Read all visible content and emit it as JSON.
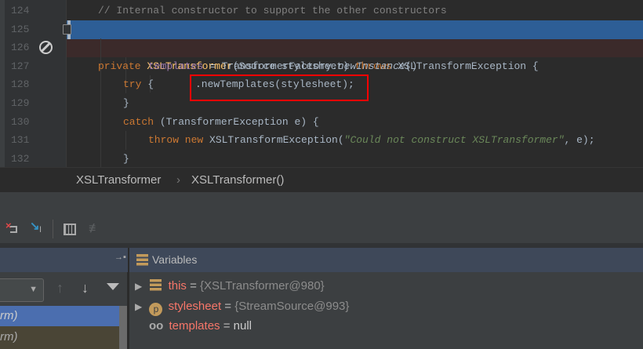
{
  "editor": {
    "lines": [
      {
        "num": "124"
      },
      {
        "num": "125"
      },
      {
        "num": "126"
      },
      {
        "num": "127"
      },
      {
        "num": "128"
      },
      {
        "num": "129"
      },
      {
        "num": "130"
      },
      {
        "num": "131"
      },
      {
        "num": "132"
      }
    ],
    "code": {
      "l124": "// Internal constructor to support the other constructors",
      "l125_kw": "private",
      "l125_fn": "XSLTransformer",
      "l125_a": "(Source stylesheet) ",
      "l125_kw2": "throws",
      "l125_b": " XSLTransformException {",
      "l126_kw": "try",
      "l126_b": " {",
      "l127_fld": "templates",
      "l127_a": " = TransformerFactory.",
      "l127_it": "newInstance",
      "l127_b": "()",
      "l128": ".newTemplates(stylesheet);",
      "l129": "}",
      "l130_kw": "catch",
      "l130_b": " (TransformerException e) {",
      "l131_kw": "throw new",
      "l131_a": " XSLTransformException(",
      "l131_str": "\"Could not construct XSLTransformer\"",
      "l131_b": ", e);",
      "l132": "}"
    }
  },
  "breadcrumb": {
    "items": [
      "XSLTransformer",
      "XSLTransformer()"
    ]
  },
  "debugger": {
    "frames": [
      {
        "label": "rm)"
      },
      {
        "label": "rm)"
      }
    ],
    "variables_title": "Variables",
    "variables": [
      {
        "name": "this",
        "eq": " = ",
        "value": "{XSLTransformer@980}"
      },
      {
        "name": "stylesheet",
        "eq": " = ",
        "value": "{StreamSource@993}"
      },
      {
        "name": "templates",
        "eq": " = ",
        "value": "null"
      }
    ]
  },
  "colors": {
    "accent": "#4b6eaf",
    "selection": "#2d5e96",
    "variable_name": "#f77669"
  }
}
